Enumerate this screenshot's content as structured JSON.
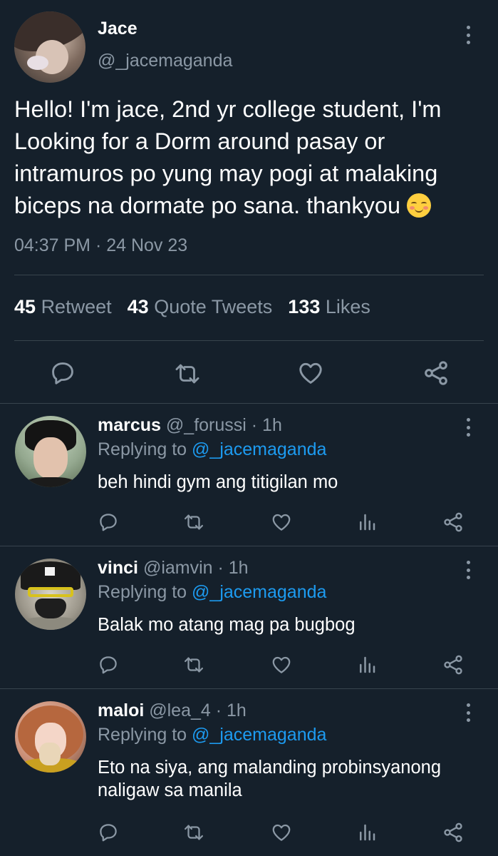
{
  "main": {
    "name": "Jace",
    "handle": "@_jacemaganda",
    "text": "Hello! I'm jace, 2nd yr college student, I'm Looking for a Dorm around pasay or intramuros po yung may pogi at malaking biceps na dormate po sana. thankyou",
    "emoji": "smiling-face-with-blush-emoji",
    "timestamp": "04:37 PM · 24 Nov 23",
    "stats": {
      "retweets": "45",
      "retweets_label": "Retweet",
      "quotes": "43",
      "quotes_label": "Quote Tweets",
      "likes": "133",
      "likes_label": "Likes"
    },
    "actions": [
      "reply-icon",
      "retweet-icon",
      "like-icon",
      "share-icon"
    ]
  },
  "replies": [
    {
      "name": "marcus",
      "meta": "@_forussi · 1h",
      "replying_prefix": "Replying to",
      "replying_to": "@_jacemaganda",
      "text": "beh hindi gym ang titigilan mo"
    },
    {
      "name": "vinci",
      "meta": "@iamvin · 1h",
      "replying_prefix": "Replying to",
      "replying_to": "@_jacemaganda",
      "text": "Balak mo atang mag pa bugbog"
    },
    {
      "name": "maloi",
      "meta": "@lea_4 · 1h",
      "replying_prefix": "Replying to",
      "replying_to": "@_jacemaganda",
      "text": "Eto na siya, ang malanding probinsyanong naligaw sa manila"
    }
  ],
  "reply_actions": [
    "reply-icon",
    "retweet-icon",
    "like-icon",
    "analytics-icon",
    "share-icon"
  ],
  "colors": {
    "background": "#15202b",
    "secondary_text": "#8b98a5",
    "link": "#1d9bf0",
    "divider": "#38444d"
  }
}
